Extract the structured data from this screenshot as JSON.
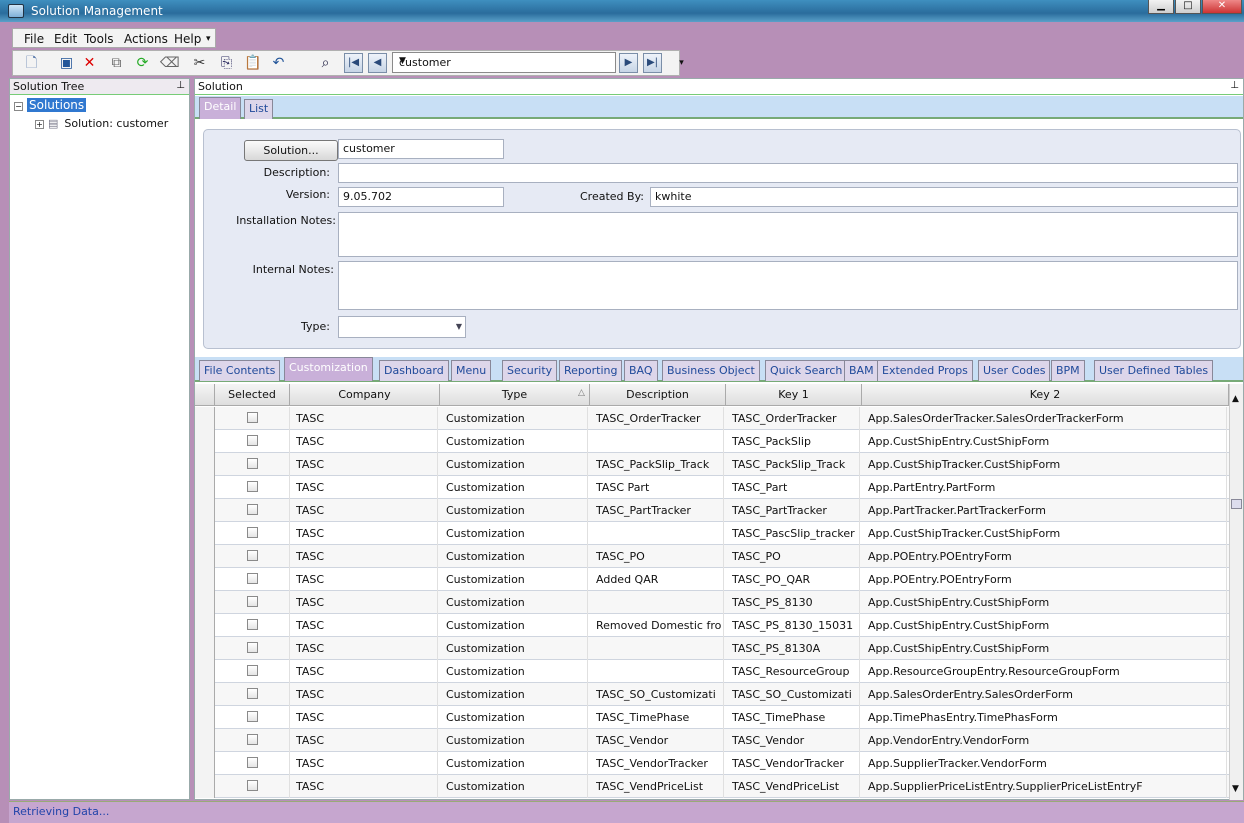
{
  "window": {
    "title": "Solution Management",
    "min": "▁",
    "max": "□",
    "close": "✕"
  },
  "menu": [
    "File",
    "Edit",
    "Tools",
    "Actions",
    "Help"
  ],
  "toolbar": {
    "search_value": "customer"
  },
  "tree": {
    "header": "Solution Tree",
    "root": "Solutions",
    "child": "Solution: customer"
  },
  "solution": {
    "header": "Solution",
    "tabs": [
      "Detail",
      "List"
    ],
    "solution_button": "Solution...",
    "solution_value": "customer",
    "description_label": "Description:",
    "description_value": "",
    "version_label": "Version:",
    "version_value": "9.05.702",
    "created_by_label": "Created By:",
    "created_by_value": "kwhite",
    "install_notes_label": "Installation Notes:",
    "internal_notes_label": "Internal Notes:",
    "type_label": "Type:",
    "type_value": ""
  },
  "content_tabs": [
    "File Contents",
    "Customization",
    "Dashboard",
    "Menu",
    "Security",
    "Reporting",
    "BAQ",
    "Business Object",
    "Quick Search",
    "BAM",
    "Extended Props",
    "User Codes",
    "BPM",
    "User Defined Tables"
  ],
  "grid": {
    "columns": [
      "Selected",
      "Company",
      "Type",
      "Description",
      "Key 1",
      "Key 2"
    ],
    "rows": [
      [
        "TASC",
        "Customization",
        "TASC_OrderTracker",
        "TASC_OrderTracker",
        "App.SalesOrderTracker.SalesOrderTrackerForm"
      ],
      [
        "TASC",
        "Customization",
        "",
        "TASC_PackSlip",
        "App.CustShipEntry.CustShipForm"
      ],
      [
        "TASC",
        "Customization",
        "TASC_PackSlip_Track",
        "TASC_PackSlip_Track",
        "App.CustShipTracker.CustShipForm"
      ],
      [
        "TASC",
        "Customization",
        "TASC Part",
        "TASC_Part",
        "App.PartEntry.PartForm"
      ],
      [
        "TASC",
        "Customization",
        "TASC_PartTracker",
        "TASC_PartTracker",
        "App.PartTracker.PartTrackerForm"
      ],
      [
        "TASC",
        "Customization",
        "",
        "TASC_PascSlip_tracker",
        "App.CustShipTracker.CustShipForm"
      ],
      [
        "TASC",
        "Customization",
        "TASC_PO",
        "TASC_PO",
        "App.POEntry.POEntryForm"
      ],
      [
        "TASC",
        "Customization",
        "Added QAR",
        "TASC_PO_QAR",
        "App.POEntry.POEntryForm"
      ],
      [
        "TASC",
        "Customization",
        "",
        "TASC_PS_8130",
        "App.CustShipEntry.CustShipForm"
      ],
      [
        "TASC",
        "Customization",
        "Removed Domestic fro",
        "TASC_PS_8130_15031",
        "App.CustShipEntry.CustShipForm"
      ],
      [
        "TASC",
        "Customization",
        "",
        "TASC_PS_8130A",
        "App.CustShipEntry.CustShipForm"
      ],
      [
        "TASC",
        "Customization",
        "",
        "TASC_ResourceGroup",
        "App.ResourceGroupEntry.ResourceGroupForm"
      ],
      [
        "TASC",
        "Customization",
        "TASC_SO_Customizati",
        "TASC_SO_Customizati",
        "App.SalesOrderEntry.SalesOrderForm"
      ],
      [
        "TASC",
        "Customization",
        "TASC_TimePhase",
        "TASC_TimePhase",
        "App.TimePhasEntry.TimePhasForm"
      ],
      [
        "TASC",
        "Customization",
        "TASC_Vendor",
        "TASC_Vendor",
        "App.VendorEntry.VendorForm"
      ],
      [
        "TASC",
        "Customization",
        "TASC_VendorTracker",
        "TASC_VendorTracker",
        "App.SupplierTracker.VendorForm"
      ],
      [
        "TASC",
        "Customization",
        "TASC_VendPriceList",
        "TASC_VendPriceList",
        "App.SupplierPriceListEntry.SupplierPriceListEntryF"
      ]
    ]
  },
  "status": "Retrieving Data..."
}
